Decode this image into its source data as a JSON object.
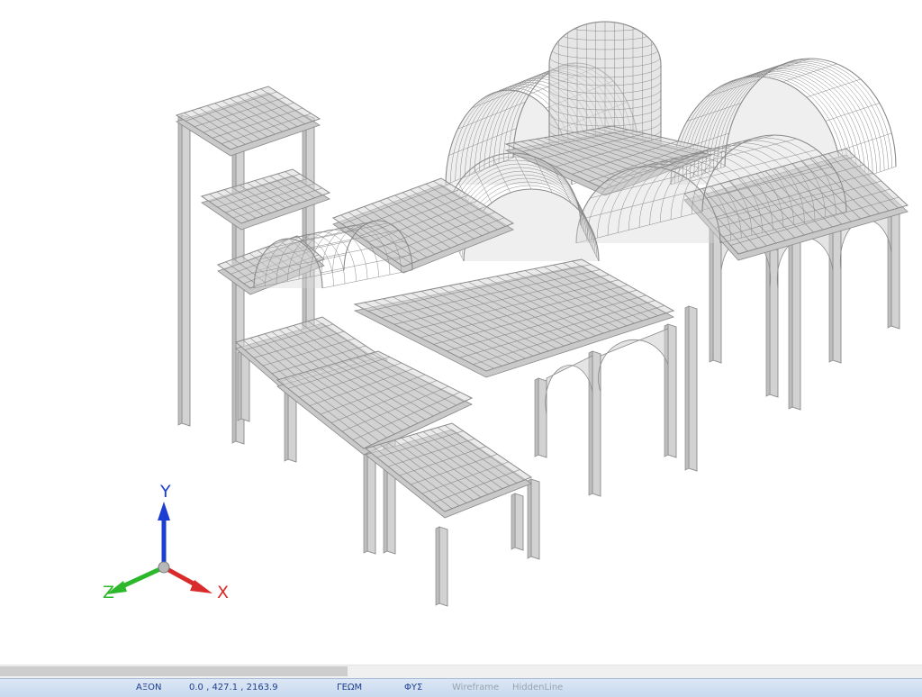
{
  "viewport": {
    "background": "#ffffff",
    "model_color": "#8a8a8a",
    "model_fill": "#d8d8d8"
  },
  "axes": {
    "x_label": "X",
    "y_label": "Y",
    "z_label": "Z",
    "x_color": "#d92b2b",
    "y_color": "#1d3fd1",
    "z_color": "#2bb82b"
  },
  "scrollbar": {
    "thumb_fraction": 0.377
  },
  "statusbar": {
    "axis_label": "ΑΞΟΝ",
    "coordinates": "0.0 , 427.1 , 2163.9",
    "geometry_label": "ΓΕΩΜ",
    "physical_label": "ΦΥΣ",
    "wireframe_label": "Wireframe",
    "hiddenline_label": "HiddenLine"
  }
}
